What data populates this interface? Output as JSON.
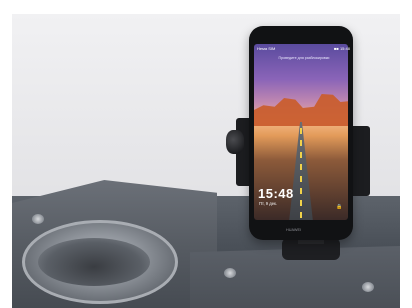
{
  "phone": {
    "status_left": "Нема SIM",
    "status_right": "■■ 15:48",
    "notification": "Проведите для разблокировки",
    "clock": "15:48",
    "date": "Пт, 9 дек.",
    "brand": "HUAWEI"
  },
  "colors": {
    "backdrop": "#e7e7e9",
    "machine_gray": "#4a5058",
    "tank_white": "#eeeeee",
    "phone_black": "#111214"
  },
  "icons": {
    "lock": "lock-icon",
    "screw": "screw-icon"
  }
}
